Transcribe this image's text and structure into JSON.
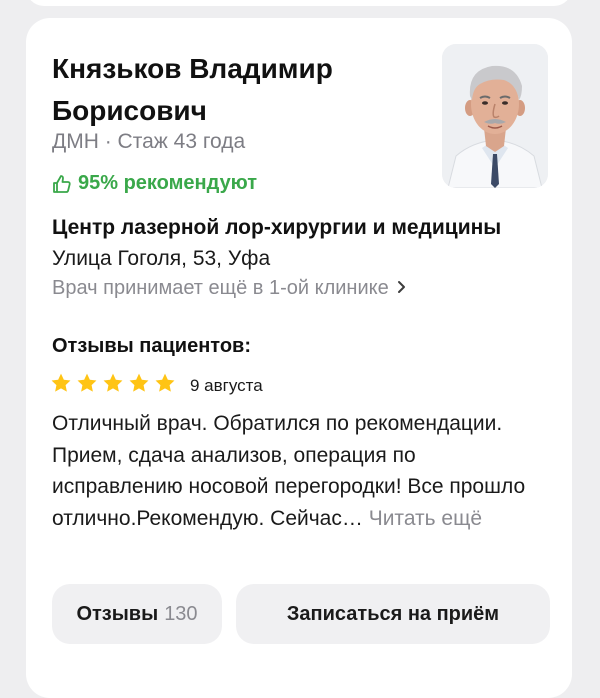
{
  "doctor": {
    "name": "Князьков Владимир Борисович",
    "credentials": "ДМН · Стаж 43 года",
    "recommend": "95% рекомендуют",
    "photo_icon": "doctor-photo"
  },
  "clinic": {
    "name": "Центр лазерной лор-хирургии и медицины",
    "address": "Улица Гоголя, 53, Уфа",
    "other_clinics": "Врач принимает ещё в 1-ой клинике"
  },
  "reviews": {
    "title": "Отзывы пациентов:",
    "rating": 5,
    "rating_max": 5,
    "date": "9 августа",
    "text": "Отличный врач. Обратился по рекомендации. Прием, сдача анализов, операция по исправлению носовой перегородки! Все прошло отлично.Рекомендую. Сейчас…",
    "read_more": "Читать ещё"
  },
  "actions": {
    "reviews_label": "Отзывы",
    "reviews_count": "130",
    "book_label": "Записаться на приём"
  },
  "colors": {
    "accent_green": "#3aa84a",
    "star": "#ffc414",
    "muted_text": "#8a8a90",
    "button_bg": "#f0f0f2"
  }
}
